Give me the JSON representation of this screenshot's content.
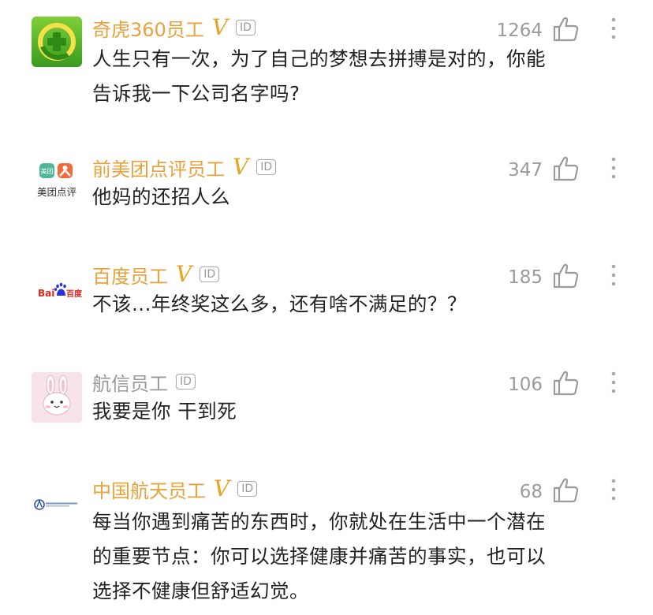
{
  "comments": [
    {
      "username": "奇虎360员工",
      "verified_mark": "V",
      "id_badge": "ID",
      "like_count": "1264",
      "text": "人生只有一次，为了自己的梦想去拼搏是对的，你能告诉我一下公司名字吗?",
      "avatar_icon": "360-security-icon"
    },
    {
      "username": "前美团点评员工",
      "verified_mark": "V",
      "id_badge": "ID",
      "like_count": "347",
      "text": "他妈的还招人么",
      "avatar_icon": "meituan-dianping-logo",
      "avatar_caption": "美团点评",
      "avatar_mark_left": "美团"
    },
    {
      "username": "百度员工",
      "verified_mark": "V",
      "id_badge": "ID",
      "like_count": "185",
      "text": "不该...年终奖这么多，还有啥不满足的？？",
      "avatar_icon": "baidu-logo",
      "avatar_word_left": "Bai",
      "avatar_word_right": "百度"
    },
    {
      "username": "航信员工",
      "verified_mark": "",
      "id_badge": "ID",
      "like_count": "106",
      "text": "我要是你  干到死",
      "avatar_icon": "bunny-avatar-icon"
    },
    {
      "username": "中国航天员工",
      "verified_mark": "V",
      "id_badge": "ID",
      "like_count": "68",
      "text": "每当你遇到痛苦的东西时，你就处在生活中一个潜在的重要节点：你可以选择健康并痛苦的事实，也可以选择不健康但舒适幻觉。",
      "avatar_icon": "china-aerospace-logo"
    }
  ],
  "colors": {
    "username_verified": "#e9a23b",
    "username_plain": "#9a9a9a",
    "text": "#222222",
    "muted": "#9b9b9b"
  }
}
